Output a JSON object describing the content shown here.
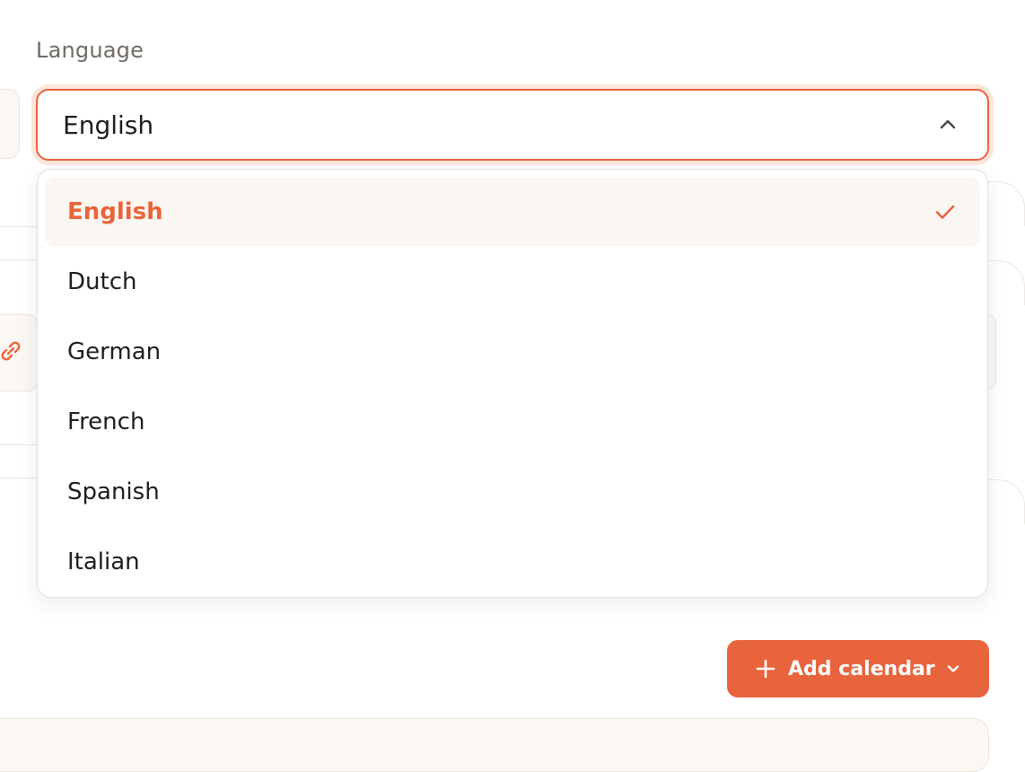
{
  "language_field": {
    "label": "Language",
    "selected_value": "English",
    "options": [
      {
        "label": "English",
        "selected": true
      },
      {
        "label": "Dutch",
        "selected": false
      },
      {
        "label": "German",
        "selected": false
      },
      {
        "label": "French",
        "selected": false
      },
      {
        "label": "Spanish",
        "selected": false
      },
      {
        "label": "Italian",
        "selected": false
      }
    ]
  },
  "actions": {
    "add_calendar_label": "Add calendar"
  },
  "icons": {
    "trigger": "chevron-up-icon",
    "selected_marker": "check-icon",
    "button_prefix": "plus-icon",
    "button_suffix": "chevron-down-icon",
    "background": "link-icon"
  },
  "colors": {
    "accent": "#e8643c",
    "focus_ring": "#fbe6dc",
    "selected_row_bg": "#faf6f1",
    "label_text": "#6f6a64",
    "body_text": "#1f1d1b"
  }
}
